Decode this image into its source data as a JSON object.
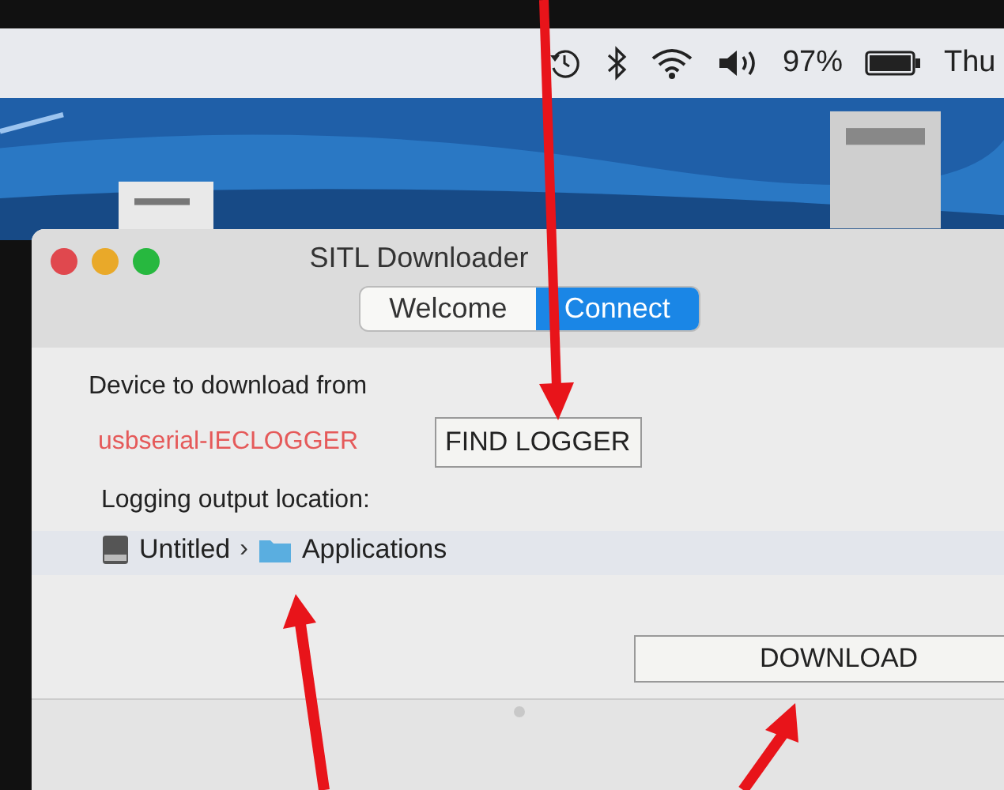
{
  "menu_bar": {
    "battery": "97%",
    "clock": "Thu"
  },
  "window": {
    "title": "SITL Downloader"
  },
  "tabs": [
    {
      "label": "Welcome",
      "selected": false
    },
    {
      "label": "Connect",
      "selected": true
    }
  ],
  "device": {
    "label": "Device to download from",
    "value": "usbserial-IECLOGGER",
    "button": "FIND LOGGER"
  },
  "output": {
    "label": "Logging output location:",
    "path": [
      {
        "kind": "disk",
        "name": "Untitled"
      },
      {
        "kind": "folder",
        "name": "Applications"
      }
    ],
    "separator": "›"
  },
  "download_button": "DOWNLOAD"
}
